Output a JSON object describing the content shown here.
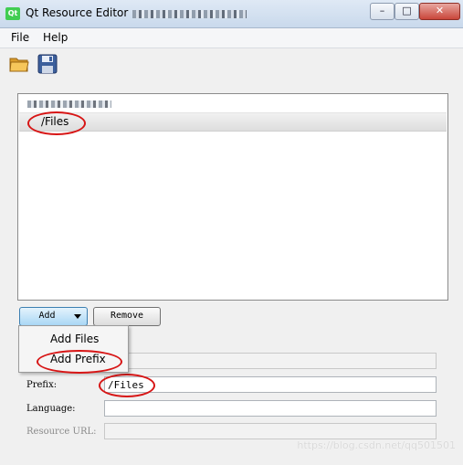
{
  "window": {
    "logo_text": "Qt",
    "title": "Qt Resource Editor",
    "controls": {
      "minimize": "–",
      "maximize": "□",
      "close": "✕"
    }
  },
  "menubar": {
    "items": [
      "File",
      "Help"
    ]
  },
  "toolbar": {
    "open_icon": "open-folder-icon",
    "save_icon": "save-disk-icon"
  },
  "tree": {
    "selected_prefix": "/Files"
  },
  "buttons": {
    "add": "Add",
    "remove": "Remove"
  },
  "add_menu": {
    "items": [
      "Add Files",
      "Add Prefix"
    ]
  },
  "form": {
    "prefix_label": "Prefix:",
    "prefix_value": "/Files",
    "language_label": "Language:",
    "language_value": "",
    "resource_url_label": "Resource URL:",
    "resource_url_value": ""
  },
  "watermark": "https://blog.csdn.net/qq501501",
  "colors": {
    "annotation_red": "#d71515",
    "tree_selected": "#dedede",
    "titlebar": "#c9d9ec"
  }
}
